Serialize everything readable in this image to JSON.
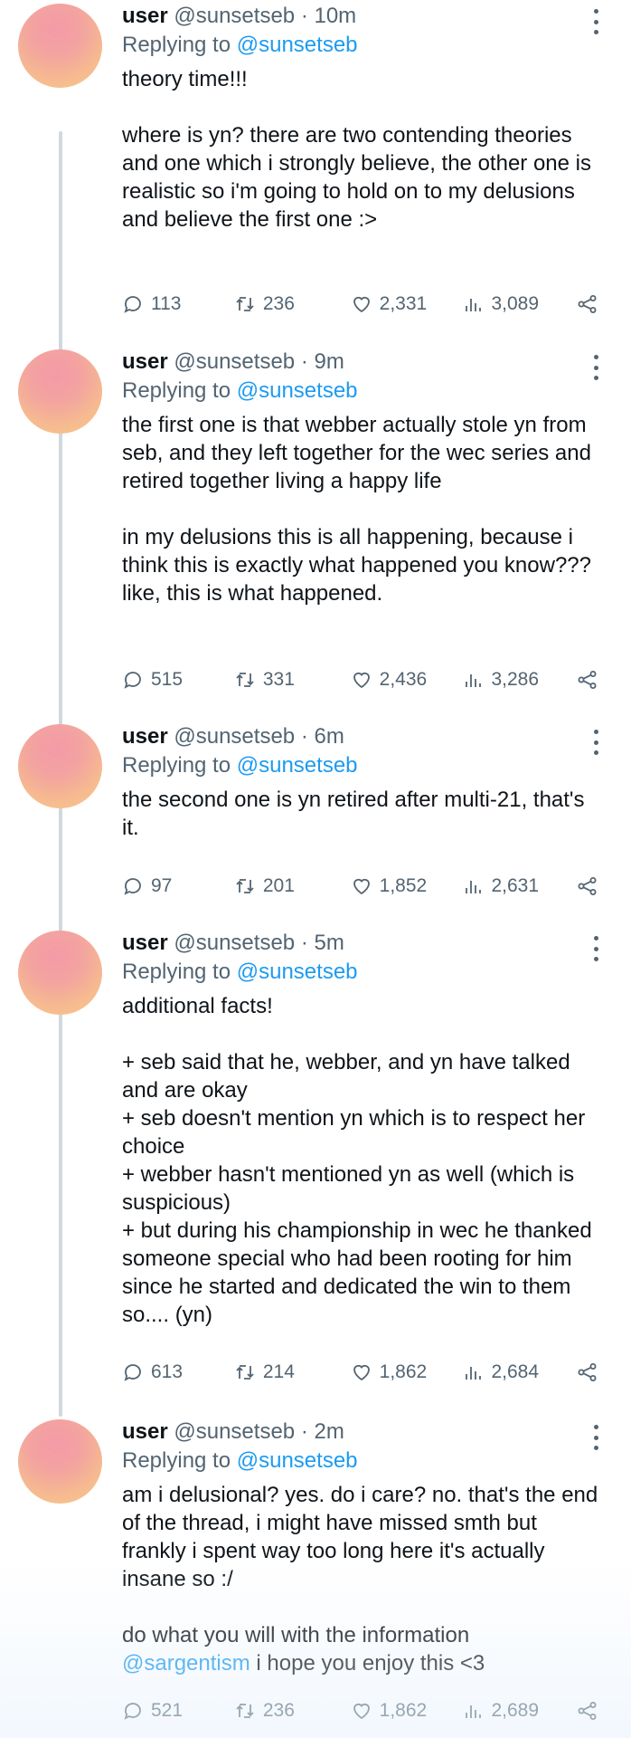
{
  "tweets": [
    {
      "display_name": "user",
      "handle": "@sunsetseb",
      "time": "10m",
      "replying_prefix": "Replying to",
      "replying_to": "@sunsetseb",
      "paragraphs": [
        "theory time!!!",
        "where is yn? there are two contending theories and one which i strongly believe, the other one is realistic so i'm going to hold on to my delusions and believe the first one :>"
      ],
      "replies": "113",
      "retweets": "236",
      "likes": "2,331",
      "views": "3,089"
    },
    {
      "display_name": "user",
      "handle": "@sunsetseb",
      "time": "9m",
      "replying_prefix": "Replying to",
      "replying_to": "@sunsetseb",
      "paragraphs": [
        "the first one is that webber actually stole yn from seb, and they left together for the wec series and retired together living a happy life",
        "in my delusions this is all happening, because i think this is exactly what happened you know??? like, this is what happened."
      ],
      "replies": "515",
      "retweets": "331",
      "likes": "2,436",
      "views": "3,286"
    },
    {
      "display_name": "user",
      "handle": "@sunsetseb",
      "time": "6m",
      "replying_prefix": "Replying to",
      "replying_to": "@sunsetseb",
      "paragraphs": [
        "the second one is yn retired after multi-21, that's it."
      ],
      "replies": "97",
      "retweets": "201",
      "likes": "1,852",
      "views": "2,631"
    },
    {
      "display_name": "user",
      "handle": "@sunsetseb",
      "time": "5m",
      "replying_prefix": "Replying to",
      "replying_to": "@sunsetseb",
      "paragraphs": [
        "additional facts!",
        "+ seb said that he, webber, and yn have talked and are okay\n+ seb doesn't mention yn which is to respect her choice\n+ webber hasn't mentioned yn as well (which is suspicious)\n+ but during his championship in wec he thanked someone special who had been rooting for him since he started and dedicated the win to them so.... (yn)"
      ],
      "replies": "613",
      "retweets": "214",
      "likes": "1,862",
      "views": "2,684"
    },
    {
      "display_name": "user",
      "handle": "@sunsetseb",
      "time": "2m",
      "replying_prefix": "Replying to",
      "replying_to": "@sunsetseb",
      "paragraphs": [
        "am i delusional? yes. do i care? no. that's the end of the thread, i might have missed smth but frankly i spent way too long here it's actually insane so :/",
        "do what you will with the information"
      ],
      "closing_mention": "@sargentism",
      "closing_text": " i hope you enjoy this <3",
      "replies": "521",
      "retweets": "236",
      "likes": "1,862",
      "views": "2,689"
    }
  ],
  "separator": " · "
}
